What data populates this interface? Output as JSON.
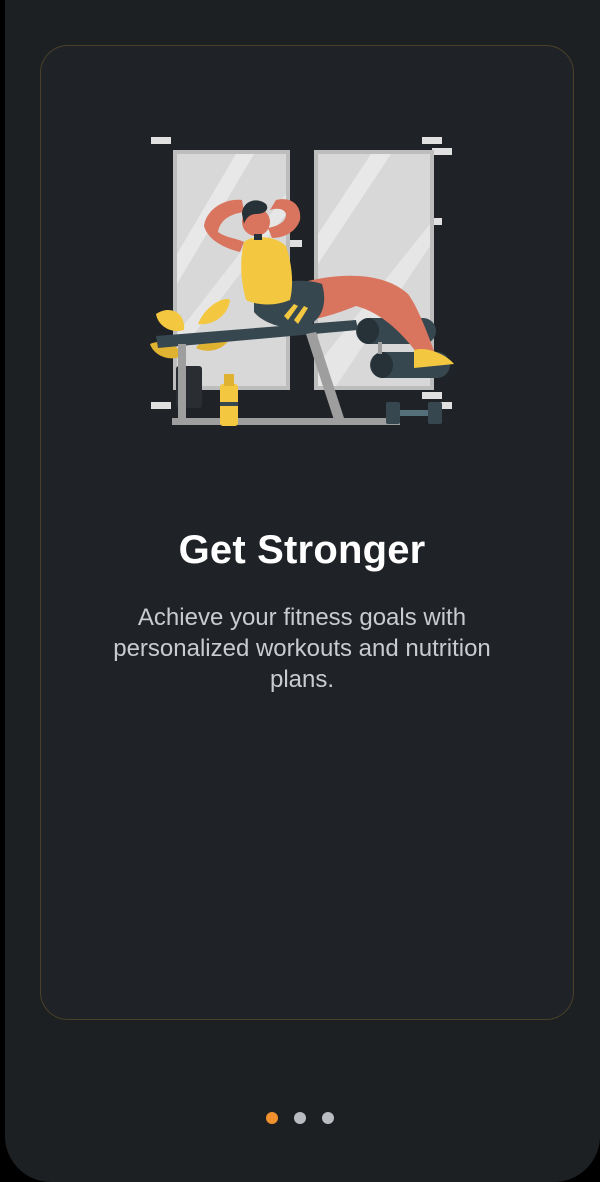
{
  "onboarding": {
    "title": "Get Stronger",
    "description": "Achieve your fitness goals with personalized workouts and nutrition plans."
  },
  "pager": {
    "count": 3,
    "active_index": 0
  },
  "colors": {
    "background": "#1d2023",
    "card_border": "#4a4128",
    "active_dot": "#f0902e",
    "inactive_dot": "#b9bcc0",
    "accent_yellow": "#f3c73f"
  }
}
